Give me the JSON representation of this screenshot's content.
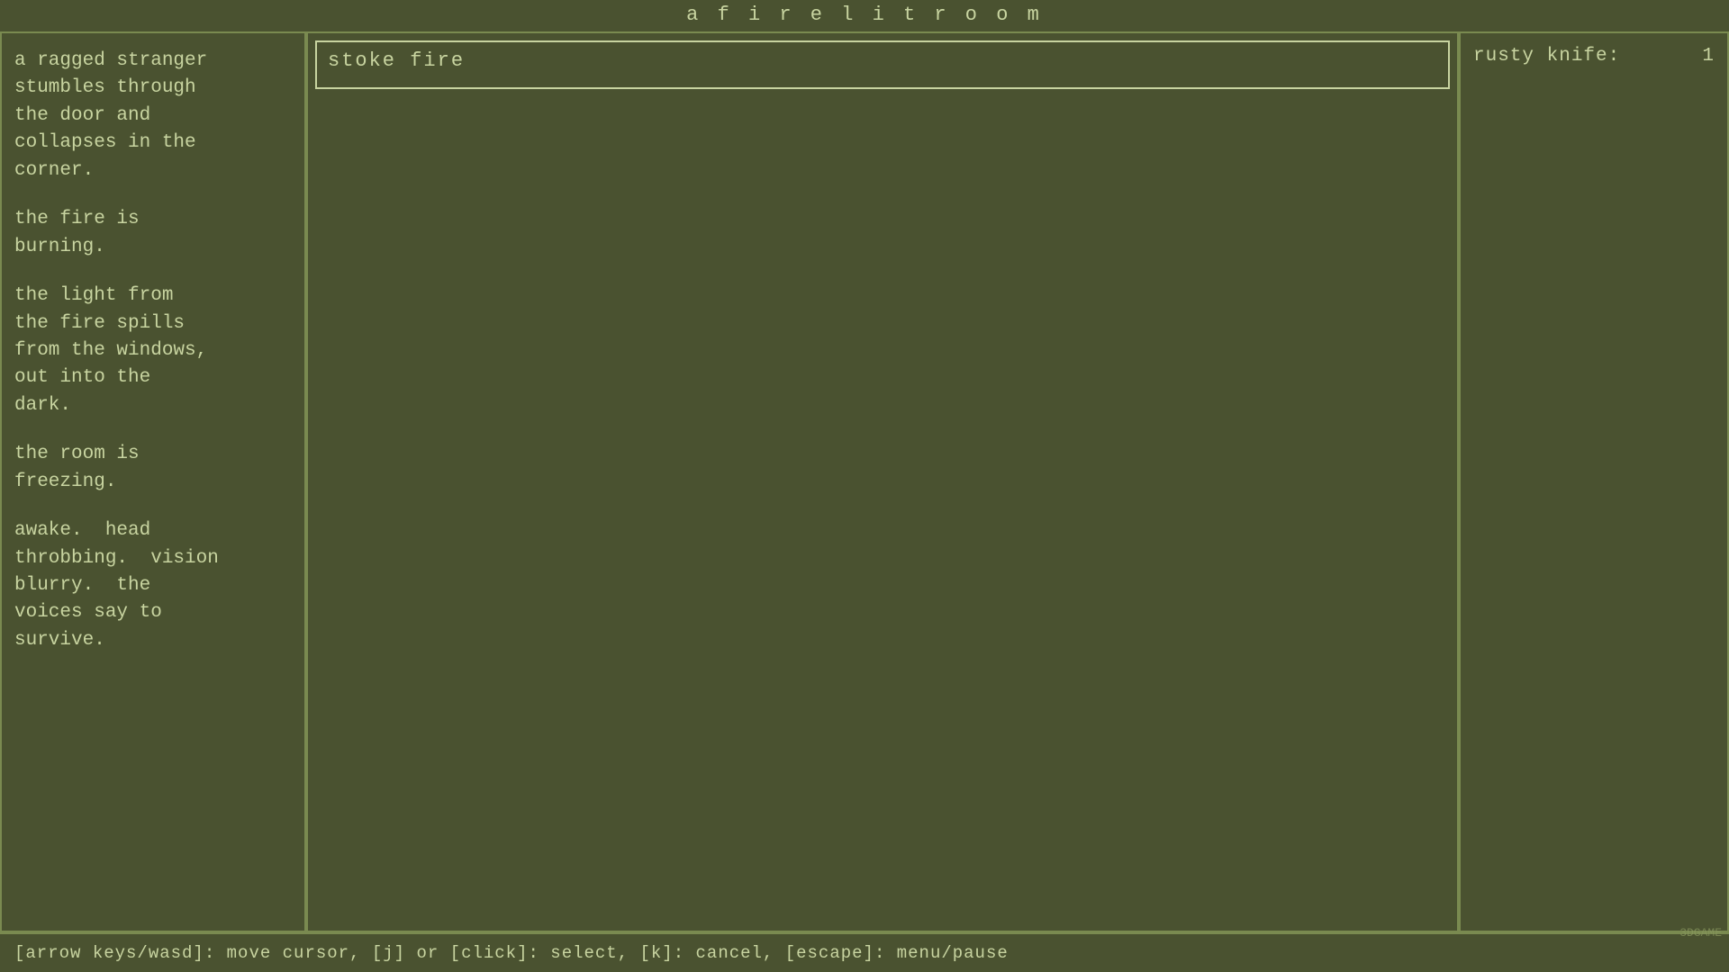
{
  "title": "a  f i r e l i t   r o o m",
  "left_panel": {
    "paragraphs": [
      "a ragged stranger\nstumbles through\nthe door and\ncollapses in the\ncorner.",
      "the fire is\nburning.",
      "the light from\nthe fire spills\nfrom the windows,\nout into the\ndark.",
      "the room is\nfreezing.",
      "awake.  head\nthrobbing.  vision\nblurry.  the\nvoices say to\nsurvive."
    ]
  },
  "command_box": {
    "text": "stoke fire"
  },
  "right_panel": {
    "items": [
      {
        "name": "rusty knife:",
        "count": "1"
      }
    ]
  },
  "status_bar": {
    "text": "[arrow keys/wasd]:  move cursor,  [j] or [click]:  select,  [k]:  cancel,  [escape]:  menu/pause"
  },
  "watermark": "3DGAME"
}
